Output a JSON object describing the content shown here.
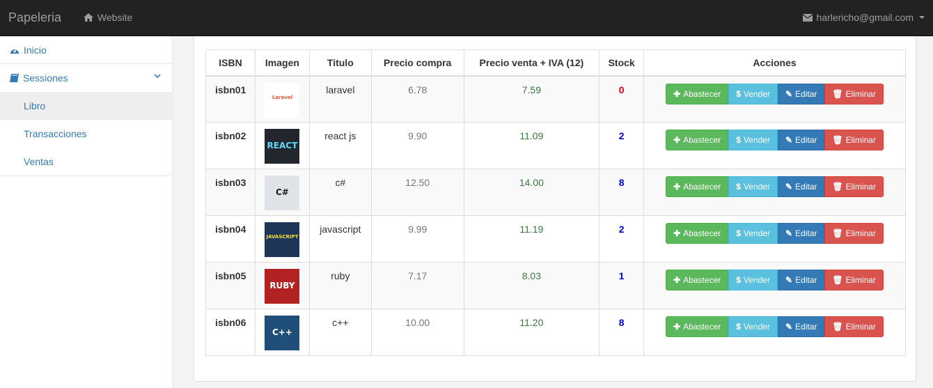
{
  "navbar": {
    "brand": "Papeleria",
    "website_label": "Website",
    "user_email": "harlericho@gmail.com"
  },
  "sidebar": {
    "inicio": "Inicio",
    "sessiones": "Sessiones",
    "sub_items": [
      "Libro",
      "Transacciones",
      "Ventas"
    ]
  },
  "table": {
    "headers": [
      "ISBN",
      "Imagen",
      "Titulo",
      "Precio compra",
      "Precio venta + IVA (12)",
      "Stock",
      "Acciones"
    ],
    "rows": [
      {
        "isbn": "isbn01",
        "titulo": "laravel",
        "compra": "6.78",
        "venta": "7.59",
        "stock": "0",
        "stock_color": "#d9001b",
        "cover_text": "Laravel",
        "cover_bg": "#ffffff",
        "cover_fg": "#f05340"
      },
      {
        "isbn": "isbn02",
        "titulo": "react js",
        "compra": "9.90",
        "venta": "11.09",
        "stock": "2",
        "stock_color": "#0000cc",
        "cover_text": "REACT",
        "cover_bg": "#22272e",
        "cover_fg": "#61dafb"
      },
      {
        "isbn": "isbn03",
        "titulo": "c#",
        "compra": "12.50",
        "venta": "14.00",
        "stock": "8",
        "stock_color": "#0000cc",
        "cover_text": "C#",
        "cover_bg": "#dfe3e8",
        "cover_fg": "#1b1b1b"
      },
      {
        "isbn": "isbn04",
        "titulo": "javascript",
        "compra": "9.99",
        "venta": "11.19",
        "stock": "2",
        "stock_color": "#0000cc",
        "cover_text": "JAVASCRIPT",
        "cover_bg": "#1d3557",
        "cover_fg": "#f7df1e"
      },
      {
        "isbn": "isbn05",
        "titulo": "ruby",
        "compra": "7.17",
        "venta": "8.03",
        "stock": "1",
        "stock_color": "#0000cc",
        "cover_text": "RUBY",
        "cover_bg": "#b22222",
        "cover_fg": "#ffffff"
      },
      {
        "isbn": "isbn06",
        "titulo": "c++",
        "compra": "10.00",
        "venta": "11.20",
        "stock": "8",
        "stock_color": "#0000cc",
        "cover_text": "C++",
        "cover_bg": "#1f4e79",
        "cover_fg": "#ffffff"
      }
    ],
    "actions": {
      "abastecer": "Abastecer",
      "vender": "Vender",
      "editar": "Editar",
      "eliminar": "Eliminar"
    }
  }
}
